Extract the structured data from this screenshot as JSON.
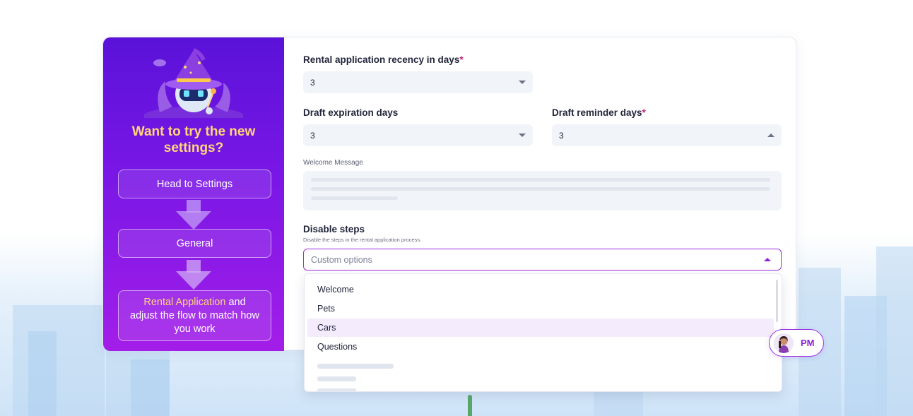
{
  "promo": {
    "title": "Want to try the new settings?",
    "steps": [
      "Head to Settings",
      "General"
    ],
    "final_step": {
      "highlight": "Rental Application",
      "rest": " and adjust the flow to match how you work"
    }
  },
  "form": {
    "recency": {
      "label": "Rental application recency in days",
      "required_mark": "*",
      "value": "3"
    },
    "draft_expiration": {
      "label": "Draft expiration days",
      "value": "3"
    },
    "draft_reminder": {
      "label": "Draft reminder days",
      "required_mark": "*",
      "value": "3"
    },
    "welcome_message": {
      "label": "Welcome Message"
    },
    "disable_steps": {
      "label": "Disable steps",
      "hint": "Disable the steps in the rental application process.",
      "placeholder": "Custom options",
      "options": [
        "Welcome",
        "Pets",
        "Cars",
        "Questions"
      ],
      "highlighted_option": "Cars"
    }
  },
  "user_chip": {
    "initials": "PM"
  },
  "colors": {
    "accent": "#8a22d8",
    "promo_gradient_top": "#5a12d8",
    "promo_gradient_bottom": "#a31ee8",
    "highlight_yellow": "#ffd67a",
    "required": "#c0267a"
  },
  "icons": [
    "wizard-robot-mascot",
    "arrow-down-icon",
    "chevron-down-icon",
    "chevron-up-icon"
  ]
}
